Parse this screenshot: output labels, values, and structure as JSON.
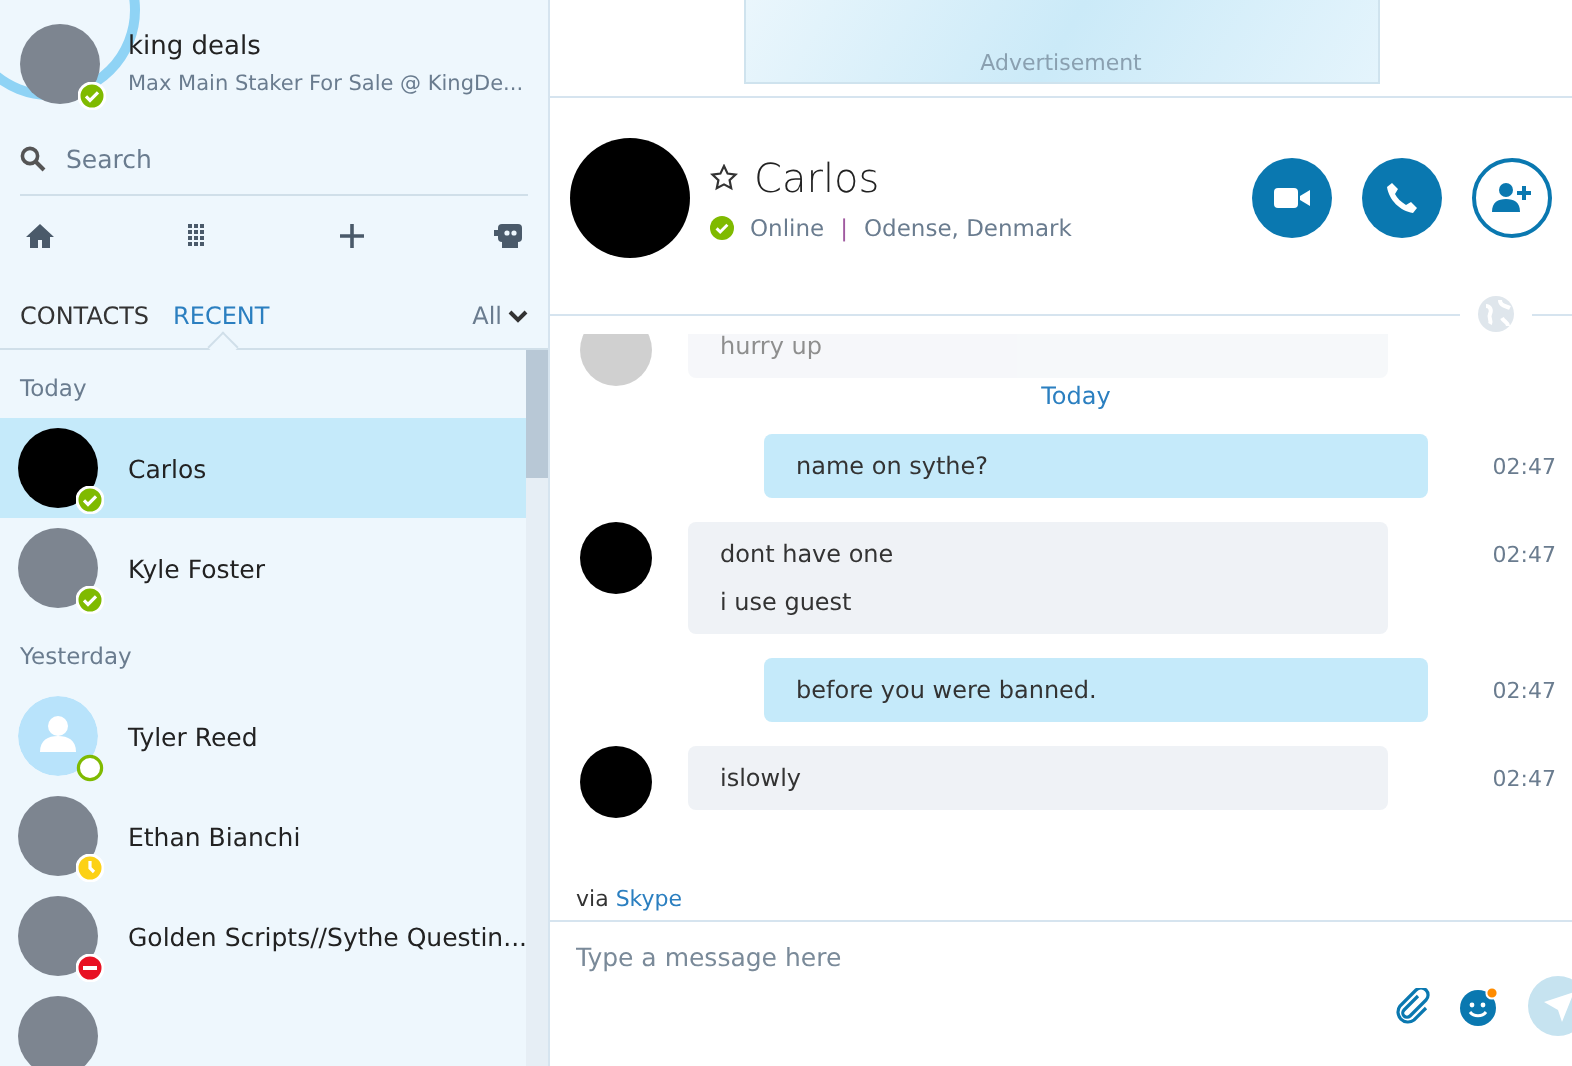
{
  "profile": {
    "name": "king deals",
    "mood": "Max Main Staker For Sale @ KingDe...",
    "status": {
      "kind": "online"
    }
  },
  "search": {
    "placeholder": "Search"
  },
  "tabs": [
    {
      "label": "CONTACTS",
      "selected": false
    },
    {
      "label": "RECENT",
      "selected": true
    }
  ],
  "filter": {
    "label": "All"
  },
  "groups": [
    {
      "label": "Today",
      "contacts": [
        {
          "name": "Carlos",
          "status": {
            "kind": "online"
          },
          "avatar": {
            "kind": "dark"
          },
          "selected": true
        },
        {
          "name": "Kyle Foster",
          "status": {
            "kind": "online"
          },
          "avatar": {
            "kind": "photo"
          },
          "selected": false
        }
      ]
    },
    {
      "label": "Yesterday",
      "contacts": [
        {
          "name": "Tyler Reed",
          "status": {
            "kind": "offline"
          },
          "avatar": {
            "kind": "default"
          },
          "selected": false
        },
        {
          "name": "Ethan Bianchi",
          "status": {
            "kind": "away"
          },
          "avatar": {
            "kind": "photo"
          },
          "selected": false
        },
        {
          "name": "Golden Scripts//Sythe Questin...",
          "status": {
            "kind": "busy"
          },
          "avatar": {
            "kind": "photo"
          },
          "selected": false
        },
        {
          "avatar": {
            "kind": "photo"
          },
          "selected": false
        }
      ]
    }
  ],
  "ad": {
    "label": "Advertisement"
  },
  "chat": {
    "name": "Carlos",
    "favorite": false,
    "status": {
      "kind": "online"
    },
    "status_text": "Online",
    "separator": "|",
    "location": "Odense, Denmark"
  },
  "messages": [
    {
      "kind": "incoming",
      "faded": true,
      "lines": [
        "hurry up"
      ]
    },
    {
      "kind": "date",
      "text": "Today"
    },
    {
      "kind": "outgoing",
      "faded": false,
      "lines": [
        "name on sythe?"
      ],
      "time": "02:47"
    },
    {
      "kind": "incoming",
      "faded": false,
      "lines": [
        "dont have one",
        "i use guest"
      ],
      "time": "02:47"
    },
    {
      "kind": "outgoing",
      "faded": false,
      "lines": [
        "before you were banned."
      ],
      "time": "02:47"
    },
    {
      "kind": "incoming",
      "faded": false,
      "lines": [
        "islowly"
      ],
      "time": "02:47"
    }
  ],
  "via": {
    "prefix": "via",
    "service": "Skype"
  },
  "composer": {
    "placeholder": "Type a message here"
  }
}
